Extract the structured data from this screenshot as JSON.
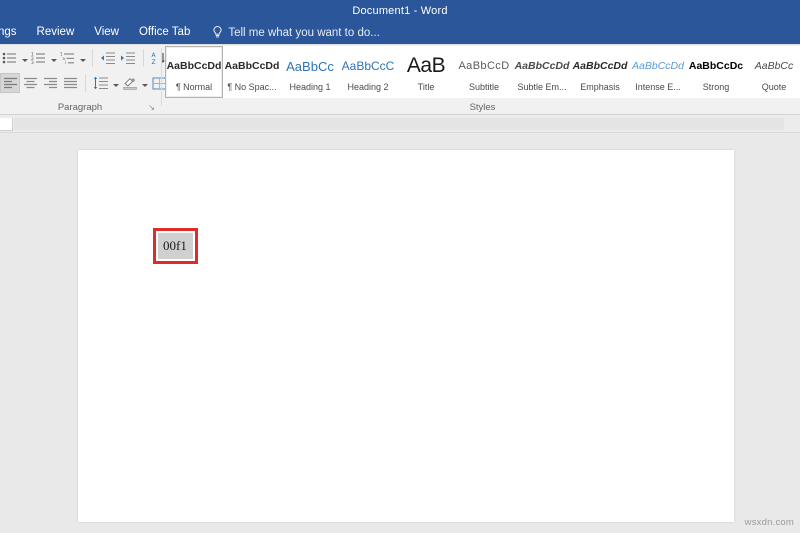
{
  "window": {
    "title": "Document1 - Word",
    "titlebar_color": "#2b579a"
  },
  "tabs": [
    {
      "label": "ngs",
      "name": "tab-mailings"
    },
    {
      "label": "Review",
      "name": "tab-review"
    },
    {
      "label": "View",
      "name": "tab-view"
    },
    {
      "label": "Office Tab",
      "name": "tab-office-tab"
    }
  ],
  "tell_me": {
    "icon": "lightbulb-icon",
    "placeholder": "Tell me what you want to do..."
  },
  "ribbon": {
    "paragraph_group": {
      "label": "Paragraph",
      "launcher": "↘",
      "row1": [
        {
          "name": "bullets-icon",
          "label": "Bullets",
          "has_caret": true
        },
        {
          "name": "numbering-icon",
          "label": "Numbering",
          "has_caret": true
        },
        {
          "name": "multilevel-list-icon",
          "label": "Multilevel List",
          "has_caret": true
        },
        {
          "name": "decrease-indent-icon",
          "label": "Decrease Indent",
          "has_caret": false
        },
        {
          "name": "increase-indent-icon",
          "label": "Increase Indent",
          "has_caret": false
        },
        {
          "name": "sort-icon",
          "label": "Sort",
          "has_caret": false
        },
        {
          "name": "show-formatting-marks-icon",
          "label": "Show/Hide ¶",
          "has_caret": false
        }
      ],
      "row2": [
        {
          "name": "align-left-icon",
          "label": "Align Left",
          "has_caret": false
        },
        {
          "name": "align-center-icon",
          "label": "Center",
          "has_caret": false
        },
        {
          "name": "align-right-icon",
          "label": "Align Right",
          "has_caret": false
        },
        {
          "name": "justify-icon",
          "label": "Justify",
          "has_caret": false
        },
        {
          "name": "line-spacing-icon",
          "label": "Line and Paragraph Spacing",
          "has_caret": true
        },
        {
          "name": "shading-icon",
          "label": "Shading",
          "has_caret": true
        },
        {
          "name": "borders-icon",
          "label": "Borders",
          "has_caret": true
        }
      ]
    },
    "styles_group": {
      "label": "Styles",
      "items": [
        {
          "preview": "AaBbCcDd",
          "name": "¶ Normal",
          "class": "sp-normal",
          "selected": true
        },
        {
          "preview": "AaBbCcDd",
          "name": "¶ No Spac...",
          "class": "sp-nospace",
          "selected": false
        },
        {
          "preview": "AaBbCc",
          "name": "Heading 1",
          "class": "sp-h1",
          "selected": false
        },
        {
          "preview": "AaBbCcC",
          "name": "Heading 2",
          "class": "sp-h2",
          "selected": false
        },
        {
          "preview": "AaB",
          "name": "Title",
          "class": "sp-title",
          "selected": false
        },
        {
          "preview": "AaBbCcD",
          "name": "Subtitle",
          "class": "sp-subtitle",
          "selected": false
        },
        {
          "preview": "AaBbCcDd",
          "name": "Subtle Em...",
          "class": "sp-subem",
          "selected": false
        },
        {
          "preview": "AaBbCcDd",
          "name": "Emphasis",
          "class": "sp-emph",
          "selected": false
        },
        {
          "preview": "AaBbCcDd",
          "name": "Intense E...",
          "class": "sp-intense",
          "selected": false
        },
        {
          "preview": "AaBbCcDc",
          "name": "Strong",
          "class": "sp-strong",
          "selected": false
        },
        {
          "preview": "AaBbCc",
          "name": "Quote",
          "class": "sp-quote",
          "selected": false
        }
      ]
    }
  },
  "document": {
    "selected_text": "00f1",
    "annotation_color": "#e02b2b",
    "selection_color": "#d0d0d0"
  },
  "watermark": "wsxdn.com"
}
